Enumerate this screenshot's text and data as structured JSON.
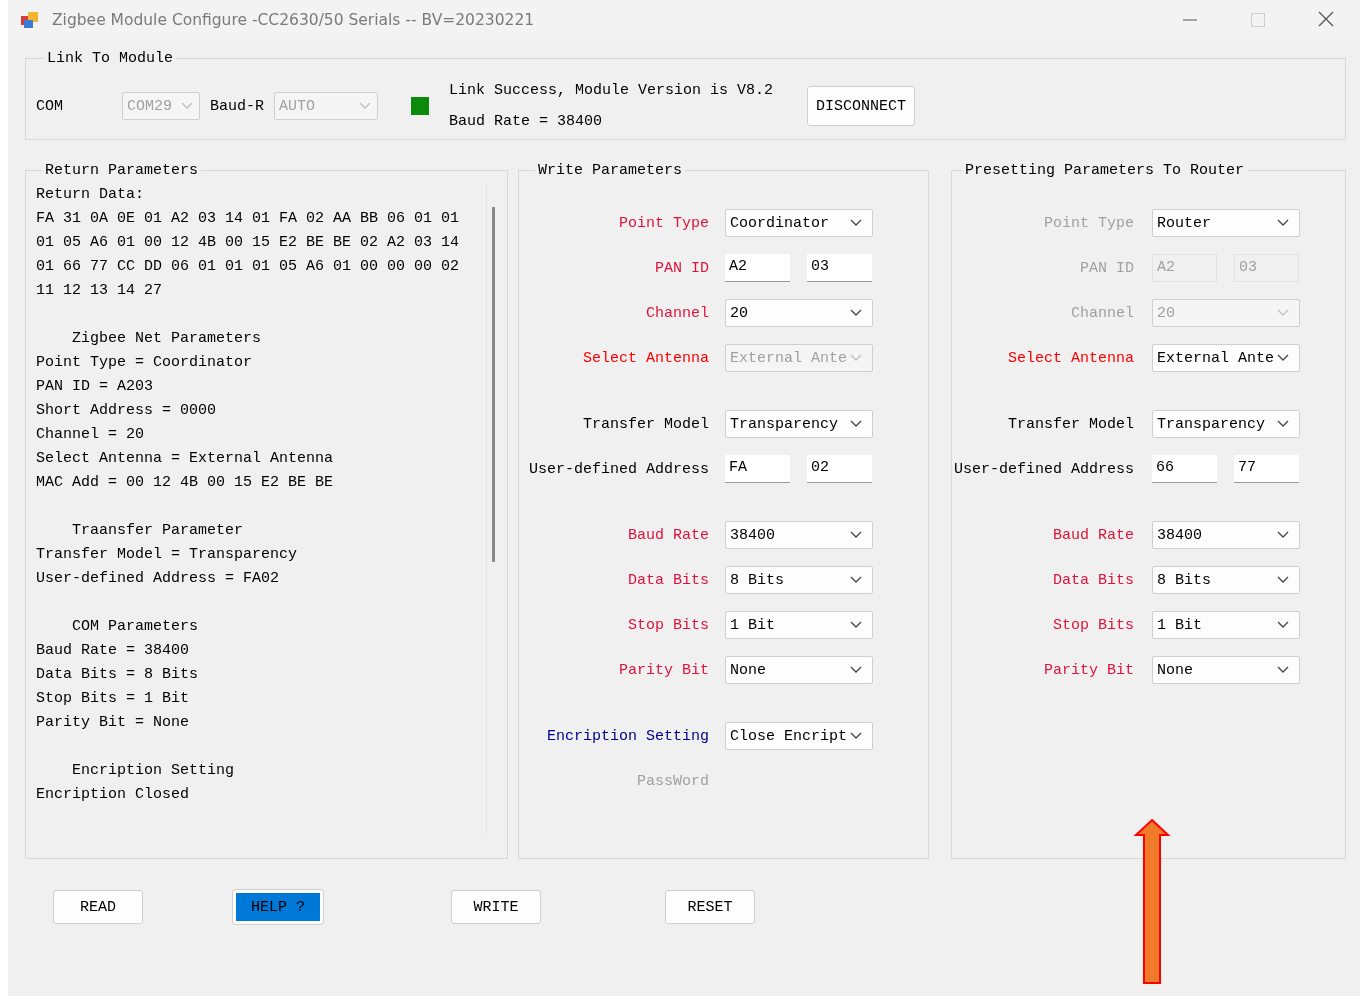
{
  "window": {
    "title": "Zigbee Module Configure -CC2630/50 Serials -- BV=20230221",
    "maximize_disabled": true
  },
  "link": {
    "title": "Link To Module",
    "com_label": "COM",
    "com": {
      "value": "COM29",
      "disabled": true
    },
    "baud_label": "Baud-R",
    "baud": {
      "value": "AUTO",
      "disabled": true
    },
    "connected": true,
    "status": "Link Success, Module Version is V8.2",
    "baud_rate": "Baud Rate = 38400",
    "button": "DISCONNECT"
  },
  "return_parameters": {
    "title": "Return Parameters",
    "blocks": [
      {
        "lines": [
          "Return Data:",
          "FA 31 0A 0E 01 A2 03 14 01 FA 02 AA BB 06 01 01",
          "01 05 A6 01 00 12 4B 00 15 E2 BE BE 02 A2 03 14",
          "01 66 77 CC DD 06 01 01 01 05 A6 01 00 00 00 02",
          "11 12 13 14 27"
        ]
      },
      {
        "heading": "Zigbee Net Parameters",
        "lines": [
          "Point Type = Coordinator",
          "PAN ID = A203",
          "Short Address = 0000",
          "Channel = 20",
          "Select Antenna = External Antenna",
          "MAC Add = 00 12 4B 00 15 E2 BE BE"
        ]
      },
      {
        "heading": "Traansfer Parameter",
        "lines": [
          "Transfer Model = Transparency",
          "User-defined Address = FA02"
        ]
      },
      {
        "heading": "COM Parameters",
        "lines": [
          "Baud Rate = 38400",
          "Data Bits = 8 Bits",
          "Stop Bits = 1 Bit",
          "Parity Bit = None"
        ]
      },
      {
        "heading": "Encription Setting",
        "lines": [
          "Encription Closed"
        ]
      }
    ]
  },
  "write_parameters": {
    "title": "Write Parameters",
    "sections": [
      [
        {
          "label": "Point Type",
          "color": "#dc143c",
          "kind": "combo",
          "value": "Coordinator",
          "disabled": false
        },
        {
          "label": "PAN ID",
          "color": "#dc143c",
          "kind": "pair",
          "values": [
            {
              "value": "A2",
              "disabled": false
            },
            {
              "value": "03",
              "disabled": false
            }
          ]
        },
        {
          "label": "Channel",
          "color": "#dc143c",
          "kind": "combo",
          "value": "20",
          "disabled": false
        },
        {
          "label": "Select Antenna",
          "color": "#ff0000",
          "kind": "combo",
          "value": "External Ante",
          "disabled": true
        }
      ],
      [
        {
          "label": "Transfer Model",
          "color": "#000000",
          "kind": "combo",
          "value": "Transparency",
          "disabled": false
        },
        {
          "label": "User-defined Address",
          "color": "#000000",
          "kind": "pair",
          "values": [
            {
              "value": "FA",
              "disabled": false
            },
            {
              "value": "02",
              "disabled": false
            }
          ]
        }
      ],
      [
        {
          "label": "Baud Rate",
          "color": "#dc143c",
          "kind": "combo",
          "value": "38400",
          "disabled": false
        },
        {
          "label": "Data Bits",
          "color": "#dc143c",
          "kind": "combo",
          "value": "8 Bits",
          "disabled": false
        },
        {
          "label": "Stop Bits",
          "color": "#dc143c",
          "kind": "combo",
          "value": "1 Bit",
          "disabled": false
        },
        {
          "label": "Parity Bit",
          "color": "#dc143c",
          "kind": "combo",
          "value": "None",
          "disabled": false
        }
      ],
      [
        {
          "label": "Encription Setting",
          "color": "#00008b",
          "kind": "combo",
          "value": "Close Encript",
          "disabled": false
        },
        {
          "label": "PassWord",
          "color": "#a0a0a0",
          "kind": "label"
        }
      ]
    ]
  },
  "router_parameters": {
    "title": "Presetting Parameters To Router",
    "sections": [
      [
        {
          "label": "Point Type",
          "color": "#a0a0a0",
          "kind": "combo",
          "value": "Router",
          "disabled": false
        },
        {
          "label": "PAN ID",
          "color": "#a0a0a0",
          "kind": "pair",
          "values": [
            {
              "value": "A2",
              "disabled": true
            },
            {
              "value": "03",
              "disabled": true
            }
          ]
        },
        {
          "label": "Channel",
          "color": "#a0a0a0",
          "kind": "combo",
          "value": "20",
          "disabled": true
        },
        {
          "label": "Select Antenna",
          "color": "#ff0000",
          "kind": "combo",
          "value": "External Ante",
          "disabled": false
        }
      ],
      [
        {
          "label": "Transfer Model",
          "color": "#000000",
          "kind": "combo",
          "value": "Transparency",
          "disabled": false
        },
        {
          "label": "User-defined Address",
          "color": "#000000",
          "kind": "pair",
          "values": [
            {
              "value": "66",
              "disabled": false
            },
            {
              "value": "77",
              "disabled": false
            }
          ]
        }
      ],
      [
        {
          "label": "Baud Rate",
          "color": "#dc143c",
          "kind": "combo",
          "value": "38400",
          "disabled": false
        },
        {
          "label": "Data Bits",
          "color": "#dc143c",
          "kind": "combo",
          "value": "8 Bits",
          "disabled": false
        },
        {
          "label": "Stop Bits",
          "color": "#dc143c",
          "kind": "combo",
          "value": "1 Bit",
          "disabled": false
        },
        {
          "label": "Parity Bit",
          "color": "#dc143c",
          "kind": "combo",
          "value": "None",
          "disabled": false
        }
      ]
    ]
  },
  "buttons": [
    {
      "label": "READ",
      "selected": false
    },
    {
      "label": "HELP ?",
      "selected": true
    },
    {
      "label": "WRITE",
      "selected": false
    },
    {
      "label": "RESET",
      "selected": false
    }
  ]
}
